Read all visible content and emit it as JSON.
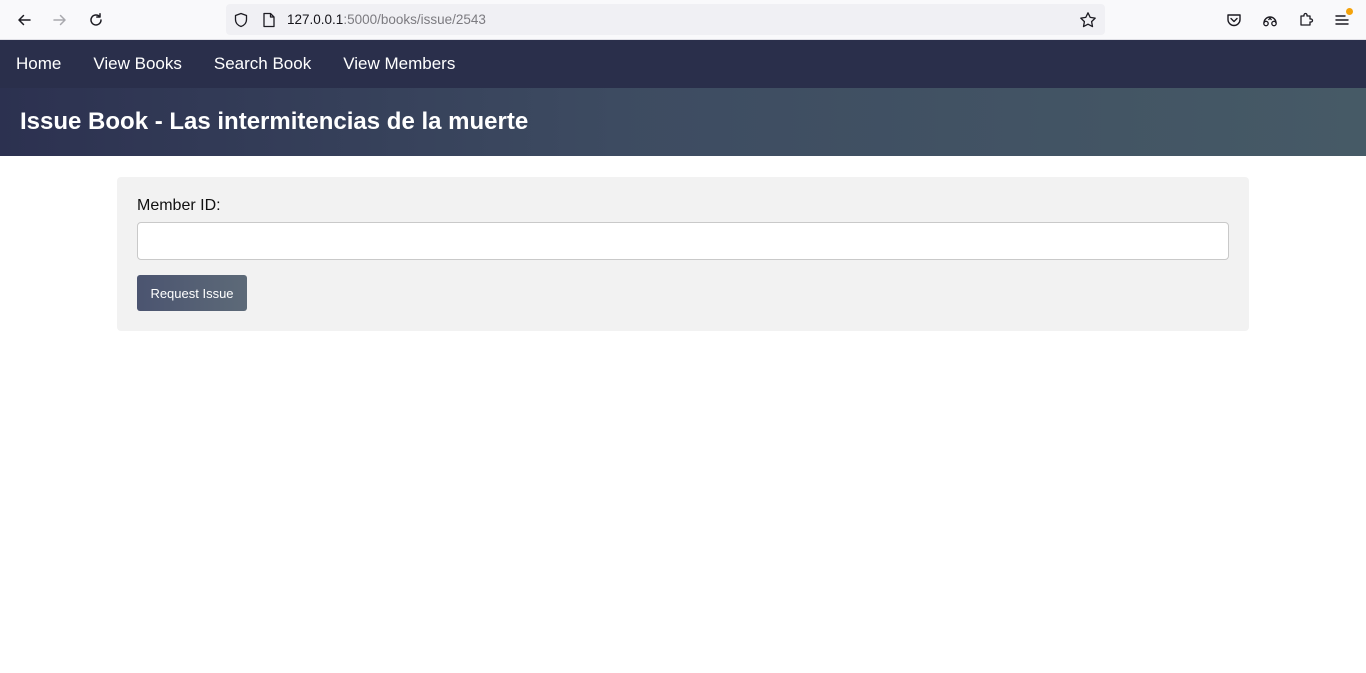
{
  "browser": {
    "url_host": "127.0.0.1",
    "url_path": ":5000/books/issue/2543",
    "icons": {
      "back": "back-arrow-icon",
      "forward": "forward-arrow-icon",
      "reload": "reload-icon",
      "shield": "tracking-protection-shield-icon",
      "page": "page-info-icon",
      "bookmark": "bookmark-star-icon",
      "pocket": "pocket-icon",
      "account": "firefox-account-icon",
      "extensions": "extensions-icon",
      "menu": "app-menu-icon"
    },
    "notification_color": "#f4a30b"
  },
  "nav": {
    "items": [
      {
        "label": "Home"
      },
      {
        "label": "View Books"
      },
      {
        "label": "Search Book"
      },
      {
        "label": "View Members"
      }
    ],
    "background": "#2a2f4b"
  },
  "header": {
    "title": "Issue Book - Las intermitencias de la muerte"
  },
  "form": {
    "member_id_label": "Member ID:",
    "member_id_value": "",
    "member_id_placeholder": "",
    "submit_label": "Request Issue"
  }
}
